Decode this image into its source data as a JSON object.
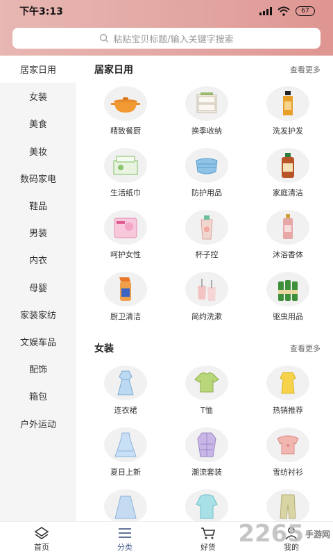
{
  "status": {
    "time": "下午3:13",
    "battery": "67"
  },
  "search": {
    "placeholder": "粘贴宝贝标题/输入关键字搜索"
  },
  "sidebar": {
    "items": [
      {
        "label": "居家日用",
        "active": true
      },
      {
        "label": "女装"
      },
      {
        "label": "美食"
      },
      {
        "label": "美妆"
      },
      {
        "label": "数码家电"
      },
      {
        "label": "鞋品"
      },
      {
        "label": "男装"
      },
      {
        "label": "内衣"
      },
      {
        "label": "母婴"
      },
      {
        "label": "家装家纺"
      },
      {
        "label": "文娱车品"
      },
      {
        "label": "配饰"
      },
      {
        "label": "箱包"
      },
      {
        "label": "户外运动"
      }
    ]
  },
  "sections": [
    {
      "title": "居家日用",
      "more": "查看更多",
      "items": [
        {
          "label": "精致餐厨",
          "icon": "pot-icon"
        },
        {
          "label": "换季收纳",
          "icon": "storage-box-icon"
        },
        {
          "label": "洗发护发",
          "icon": "shampoo-icon"
        },
        {
          "label": "生活纸巾",
          "icon": "tissue-icon"
        },
        {
          "label": "防护用品",
          "icon": "mask-icon"
        },
        {
          "label": "家庭清洁",
          "icon": "cleaner-bottle-icon"
        },
        {
          "label": "呵护女性",
          "icon": "sanitary-pad-icon"
        },
        {
          "label": "杯子控",
          "icon": "cup-icon"
        },
        {
          "label": "沐浴香体",
          "icon": "perfume-icon"
        },
        {
          "label": "厨卫清洁",
          "icon": "spray-bottle-icon"
        },
        {
          "label": "简约洗漱",
          "icon": "toothbrush-cup-icon"
        },
        {
          "label": "驱虫用品",
          "icon": "green-bottles-icon"
        }
      ]
    },
    {
      "title": "女装",
      "more": "查看更多",
      "items": [
        {
          "label": "连衣裙",
          "icon": "dress-icon"
        },
        {
          "label": "T恤",
          "icon": "tshirt-icon"
        },
        {
          "label": "热销推荐",
          "icon": "yellow-top-icon"
        },
        {
          "label": "夏日上新",
          "icon": "summer-dress-icon"
        },
        {
          "label": "潮流套装",
          "icon": "suit-icon"
        },
        {
          "label": "雪纺衬衫",
          "icon": "chiffon-shirt-icon"
        },
        {
          "label": "",
          "icon": "skirt-icon"
        },
        {
          "label": "",
          "icon": "blouse-icon"
        },
        {
          "label": "",
          "icon": "pants-icon"
        }
      ]
    }
  ],
  "tabs": [
    {
      "label": "首页",
      "icon": "home-icon"
    },
    {
      "label": "分类",
      "icon": "category-icon",
      "active": true
    },
    {
      "label": "好货",
      "icon": "cart-icon"
    },
    {
      "label": "我的",
      "icon": "profile-icon"
    }
  ],
  "watermark": {
    "text": "2265",
    "sub": "手游网"
  },
  "colors": {
    "header": "#e2a5a1",
    "active_tab": "#4b5f8c"
  }
}
